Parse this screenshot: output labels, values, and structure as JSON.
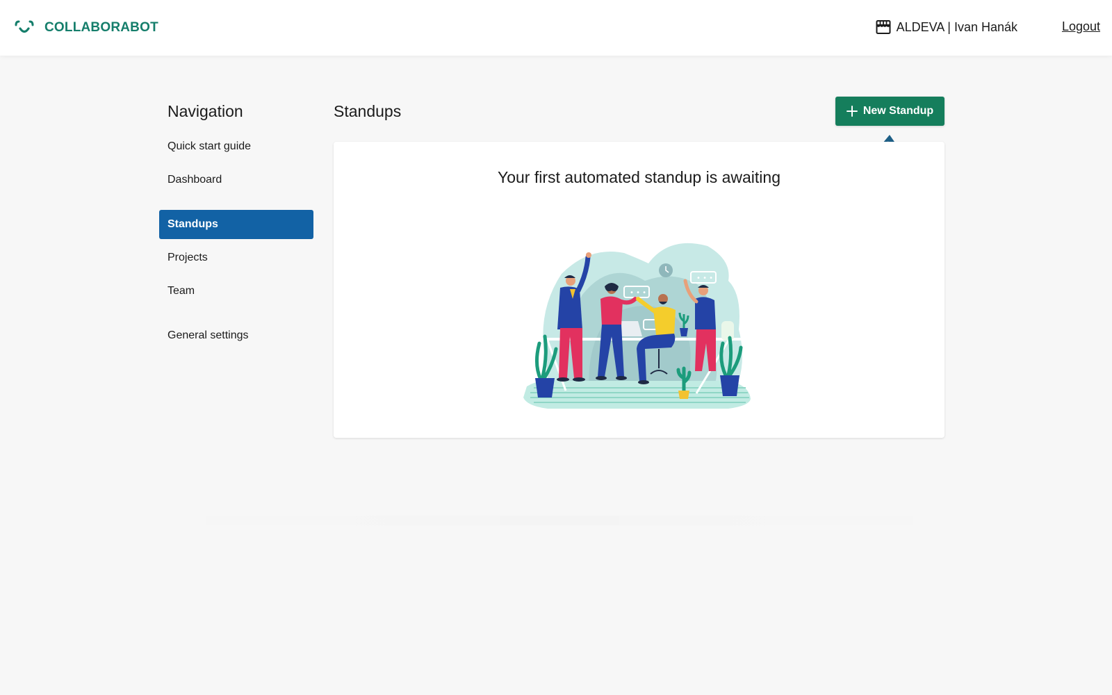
{
  "header": {
    "brand_name": "COLLABORABOT",
    "account_label": "ALDEVA | Ivan Hanák",
    "logout_label": "Logout",
    "brand_color": "#157e6b",
    "icons": {
      "logo": "smile-logo-icon",
      "account": "store-icon"
    }
  },
  "sidebar": {
    "title": "Navigation",
    "items": [
      {
        "label": "Quick start guide",
        "active": false
      },
      {
        "label": "Dashboard",
        "active": false
      },
      {
        "label": "Standups",
        "active": true
      },
      {
        "label": "Projects",
        "active": false
      },
      {
        "label": "Team",
        "active": false
      },
      {
        "label": "General settings",
        "active": false
      }
    ],
    "active_color": "#1262a5"
  },
  "main": {
    "title": "Standups",
    "new_button_label": "New Standup",
    "new_button_color": "#157e5c",
    "empty_state": {
      "heading": "Your first automated standup is awaiting",
      "illustration": "team-celebration-illustration",
      "hint_icon": "curved-arrow-up-icon"
    }
  }
}
